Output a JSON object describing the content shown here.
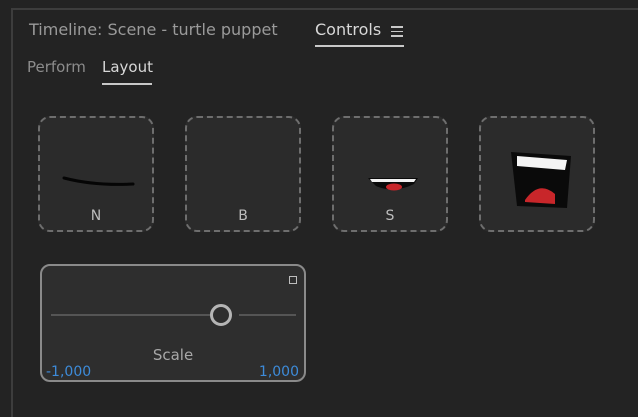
{
  "header": {
    "title": "Timeline: Scene - turtle puppet",
    "active_panel": "Controls",
    "menu_icon": "hamburger-icon"
  },
  "tabs": [
    {
      "label": "Perform",
      "active": false
    },
    {
      "label": "Layout",
      "active": true
    }
  ],
  "triggers": [
    {
      "label": "N",
      "icon": "neutral-mouth-icon"
    },
    {
      "label": "B",
      "icon": "blank-mouth-icon"
    },
    {
      "label": "S",
      "icon": "smile-mouth-icon"
    },
    {
      "label": "",
      "icon": "open-mouth-icon"
    }
  ],
  "slider": {
    "label": "Scale",
    "min": "-1,000",
    "max": "1,000",
    "value_fraction": 0.65
  },
  "colors": {
    "background": "#232323",
    "accent_blue": "#3d8bd9",
    "mouth_red": "#c8262a"
  }
}
